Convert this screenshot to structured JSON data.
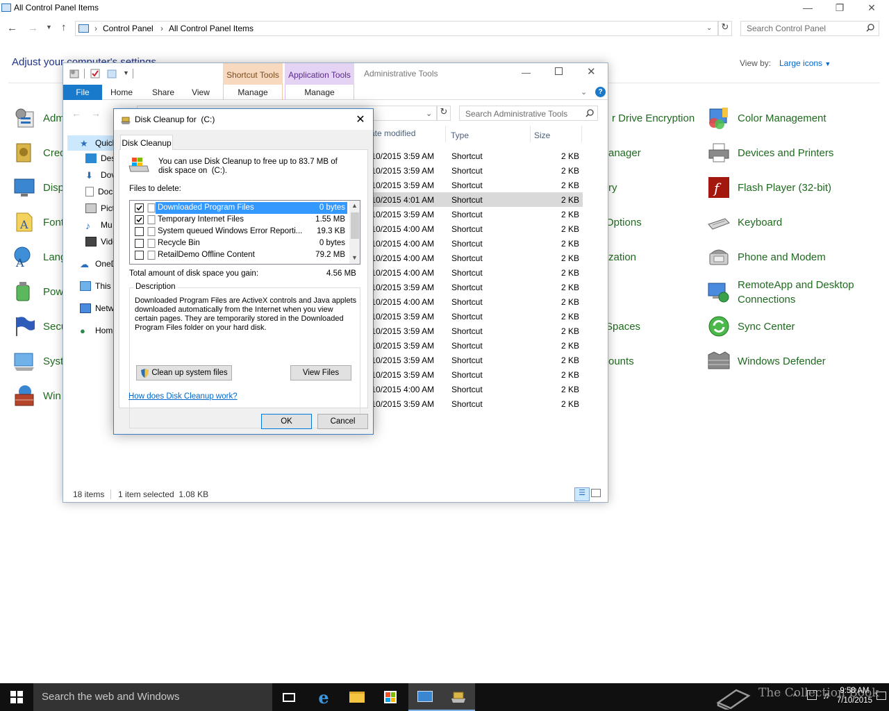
{
  "control_panel": {
    "window_title": "All Control Panel Items",
    "breadcrumbs": [
      "Control Panel",
      "All Control Panel Items"
    ],
    "search_placeholder": "Search Control Panel",
    "heading": "Adjust your computer's settings",
    "view_by_label": "View by:",
    "view_by_value": "Large icons",
    "left_items": [
      "Adm",
      "Cred",
      "Disp",
      "Font",
      "Lang",
      "Pow",
      "Secu",
      "Syst",
      "Win"
    ],
    "middle_items": [
      "r Drive Encryption",
      "anager",
      "ry",
      "Options",
      "zation",
      "Spaces",
      "ounts"
    ],
    "right_items": [
      {
        "label": "Color Management",
        "icon": "color-management-icon"
      },
      {
        "label": "Devices and Printers",
        "icon": "printer-icon"
      },
      {
        "label": "Flash Player (32-bit)",
        "icon": "flash-icon"
      },
      {
        "label": "Keyboard",
        "icon": "keyboard-icon"
      },
      {
        "label": "Phone and Modem",
        "icon": "phone-icon"
      },
      {
        "label": "RemoteApp and Desktop Connections",
        "icon": "remote-desktop-icon"
      },
      {
        "label": "Sync Center",
        "icon": "sync-icon"
      },
      {
        "label": "Windows Defender",
        "icon": "defender-icon"
      }
    ]
  },
  "explorer": {
    "tabs": {
      "file": "File",
      "home": "Home",
      "share": "Share",
      "view": "View",
      "manage1": "Manage",
      "manage2": "Manage"
    },
    "contextual": {
      "shortcut_tools": "Shortcut Tools",
      "application_tools": "Application Tools",
      "title": "Administrative Tools"
    },
    "search_placeholder": "Search Administrative Tools",
    "columns": {
      "date": "ate modified",
      "type": "Type",
      "size": "Size"
    },
    "nav": [
      "Quick",
      "Des",
      "Dov",
      "Doc",
      "Pict",
      "Mu",
      "Vide",
      "OneD",
      "This",
      "Netw",
      "Hom"
    ],
    "rows": [
      {
        "date": "/10/2015 3:59 AM",
        "type": "Shortcut",
        "size": "2 KB"
      },
      {
        "date": "/10/2015 3:59 AM",
        "type": "Shortcut",
        "size": "2 KB"
      },
      {
        "date": "/10/2015 3:59 AM",
        "type": "Shortcut",
        "size": "2 KB"
      },
      {
        "date": "/10/2015 4:01 AM",
        "type": "Shortcut",
        "size": "2 KB"
      },
      {
        "date": "/10/2015 3:59 AM",
        "type": "Shortcut",
        "size": "2 KB"
      },
      {
        "date": "/10/2015 4:00 AM",
        "type": "Shortcut",
        "size": "2 KB"
      },
      {
        "date": "/10/2015 4:00 AM",
        "type": "Shortcut",
        "size": "2 KB"
      },
      {
        "date": "/10/2015 4:00 AM",
        "type": "Shortcut",
        "size": "2 KB"
      },
      {
        "date": "/10/2015 4:00 AM",
        "type": "Shortcut",
        "size": "2 KB"
      },
      {
        "date": "/10/2015 3:59 AM",
        "type": "Shortcut",
        "size": "2 KB"
      },
      {
        "date": "/10/2015 4:00 AM",
        "type": "Shortcut",
        "size": "2 KB"
      },
      {
        "date": "/10/2015 3:59 AM",
        "type": "Shortcut",
        "size": "2 KB"
      },
      {
        "date": "/10/2015 3:59 AM",
        "type": "Shortcut",
        "size": "2 KB"
      },
      {
        "date": "/10/2015 3:59 AM",
        "type": "Shortcut",
        "size": "2 KB"
      },
      {
        "date": "/10/2015 3:59 AM",
        "type": "Shortcut",
        "size": "2 KB"
      },
      {
        "date": "/10/2015 3:59 AM",
        "type": "Shortcut",
        "size": "2 KB"
      },
      {
        "date": "/10/2015 4:00 AM",
        "type": "Shortcut",
        "size": "2 KB"
      },
      {
        "date": "/10/2015 3:59 AM",
        "type": "Shortcut",
        "size": "2 KB"
      }
    ],
    "selected_row": 3,
    "status_items": "18 items",
    "status_selected": "1 item selected  1.08 KB"
  },
  "disk_cleanup": {
    "title": "Disk Cleanup for  (C:)",
    "tab": "Disk Cleanup",
    "intro": "You can use Disk Cleanup to free up to 83.7 MB of disk space on  (C:).",
    "files_label": "Files to delete:",
    "files": [
      {
        "name": "Downloaded Program Files",
        "size": "0 bytes",
        "checked": true,
        "selected": true
      },
      {
        "name": "Temporary Internet Files",
        "size": "1.55 MB",
        "checked": true,
        "selected": false
      },
      {
        "name": "System queued Windows Error Reporti...",
        "size": "19.3 KB",
        "checked": false,
        "selected": false
      },
      {
        "name": "Recycle Bin",
        "size": "0 bytes",
        "checked": false,
        "selected": false
      },
      {
        "name": "RetailDemo Offline Content",
        "size": "79.2 MB",
        "checked": false,
        "selected": false
      }
    ],
    "total_label": "Total amount of disk space you gain:",
    "total_value": "4.56 MB",
    "description_label": "Description",
    "description": "Downloaded Program Files are ActiveX controls and Java applets downloaded automatically from the Internet when you view certain pages. They are temporarily stored in the Downloaded Program Files folder on your hard disk.",
    "cleanup_system_button": "Clean up system files",
    "view_files_button": "View Files",
    "help_link": "How does Disk Cleanup work?",
    "ok_button": "OK",
    "cancel_button": "Cancel"
  },
  "taskbar": {
    "search_placeholder": "Search the web and Windows",
    "time": "9:58 AM",
    "date": "7/10/2015",
    "watermark": "The Collection Book"
  },
  "colors": {
    "accent": "#1979ca",
    "link_green": "#1e6a1e",
    "selection": "#3399ff",
    "taskbar": "#101010"
  }
}
